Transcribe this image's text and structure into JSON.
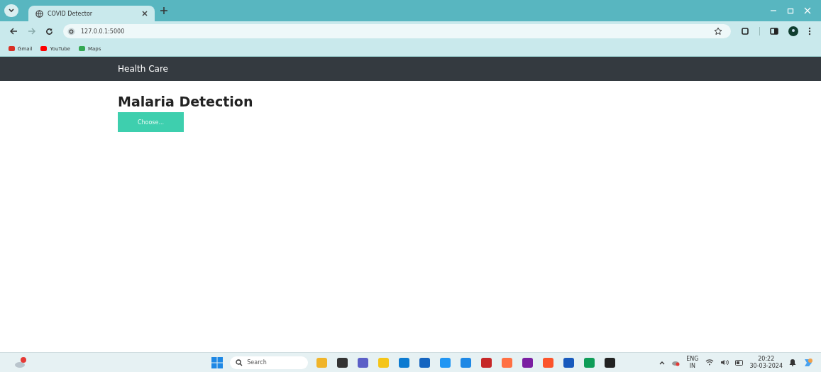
{
  "browser": {
    "tabs": [
      {
        "title": "COVID Detector",
        "selected": true
      }
    ],
    "address": "127.0.0.1:5000",
    "bookmarks": [
      {
        "label": "Gmail",
        "color": "#d93025"
      },
      {
        "label": "YouTube",
        "color": "#ff0000"
      },
      {
        "label": "Maps",
        "color": "#34a853"
      }
    ]
  },
  "navbar": {
    "brand": "Health Care"
  },
  "page": {
    "heading": "Malaria Detection",
    "button": "Choose..."
  },
  "taskbar": {
    "search": {
      "placeholder": "Search"
    },
    "language": "ENG",
    "region": "IN",
    "time": "20:22",
    "date": "30-03-2024"
  }
}
